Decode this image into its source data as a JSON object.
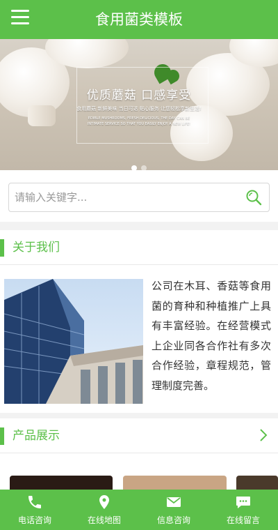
{
  "header": {
    "title": "食用菌类模板",
    "menu_icon": "hamburger-icon"
  },
  "banner": {
    "headline": "优质蘑菇 口感享受",
    "tagline_cn": "食用蘑菇  新鲜美味  当日可达  贴心服务  让您轻松享新生活!",
    "tagline_en": "EDIBLE MUSHROOMS, FRESH DELICIOUS, THE DAY CAN BE INTIMATE SERVICE SO THAT YOU EASILY ENJOY A NEW LIFE!",
    "slide_count": 2,
    "active_slide": 1
  },
  "search": {
    "placeholder": "请输入关键字...",
    "value": "",
    "icon": "search-icon"
  },
  "about": {
    "title": "关于我们",
    "text": "公司在木耳、香菇等食用菌的育种和种植推广上具有丰富经验。在经营模式上企业同各合作社有多次合作经验，章程规范，管理制度完善。"
  },
  "products": {
    "title": "产品展示",
    "more_icon": "chevron-right-icon"
  },
  "bottom_nav": [
    {
      "label": "电话咨询",
      "icon": "phone-icon"
    },
    {
      "label": "在线地图",
      "icon": "map-pin-icon"
    },
    {
      "label": "信息咨询",
      "icon": "mail-icon"
    },
    {
      "label": "在线留言",
      "icon": "chat-icon"
    }
  ],
  "colors": {
    "accent": "#5cc04a",
    "text": "#333333",
    "background": "#f2f2f2"
  }
}
